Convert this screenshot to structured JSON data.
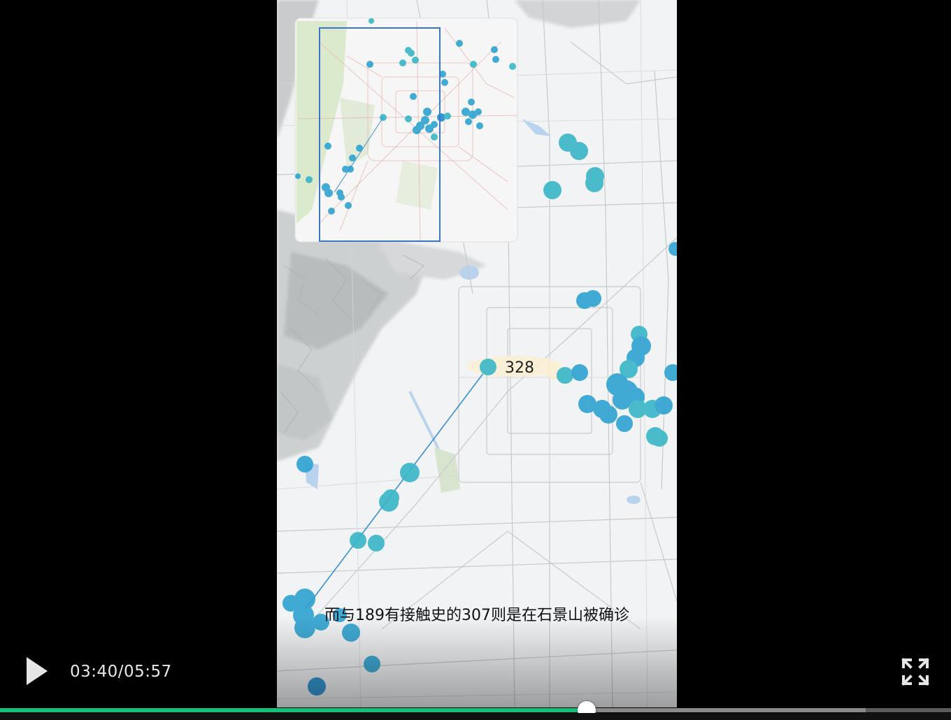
{
  "video": {
    "subtitle": "而与189有接触史的307则是在石景山被确诊",
    "map_label": "328",
    "inset_map": {
      "frame_color": "#3a76c4"
    },
    "point_colors": [
      "#2ea3d1",
      "#38b6c6",
      "#1f8fcf"
    ]
  },
  "player": {
    "time_display": "03:40/05:57",
    "current_time": "03:40",
    "duration": "05:57",
    "progress_fraction": 0.617,
    "buffered_fraction": 0.91,
    "progress_color": "#13c27a",
    "icons": {
      "play": "play-icon",
      "fullscreen": "fullscreen-icon"
    }
  }
}
